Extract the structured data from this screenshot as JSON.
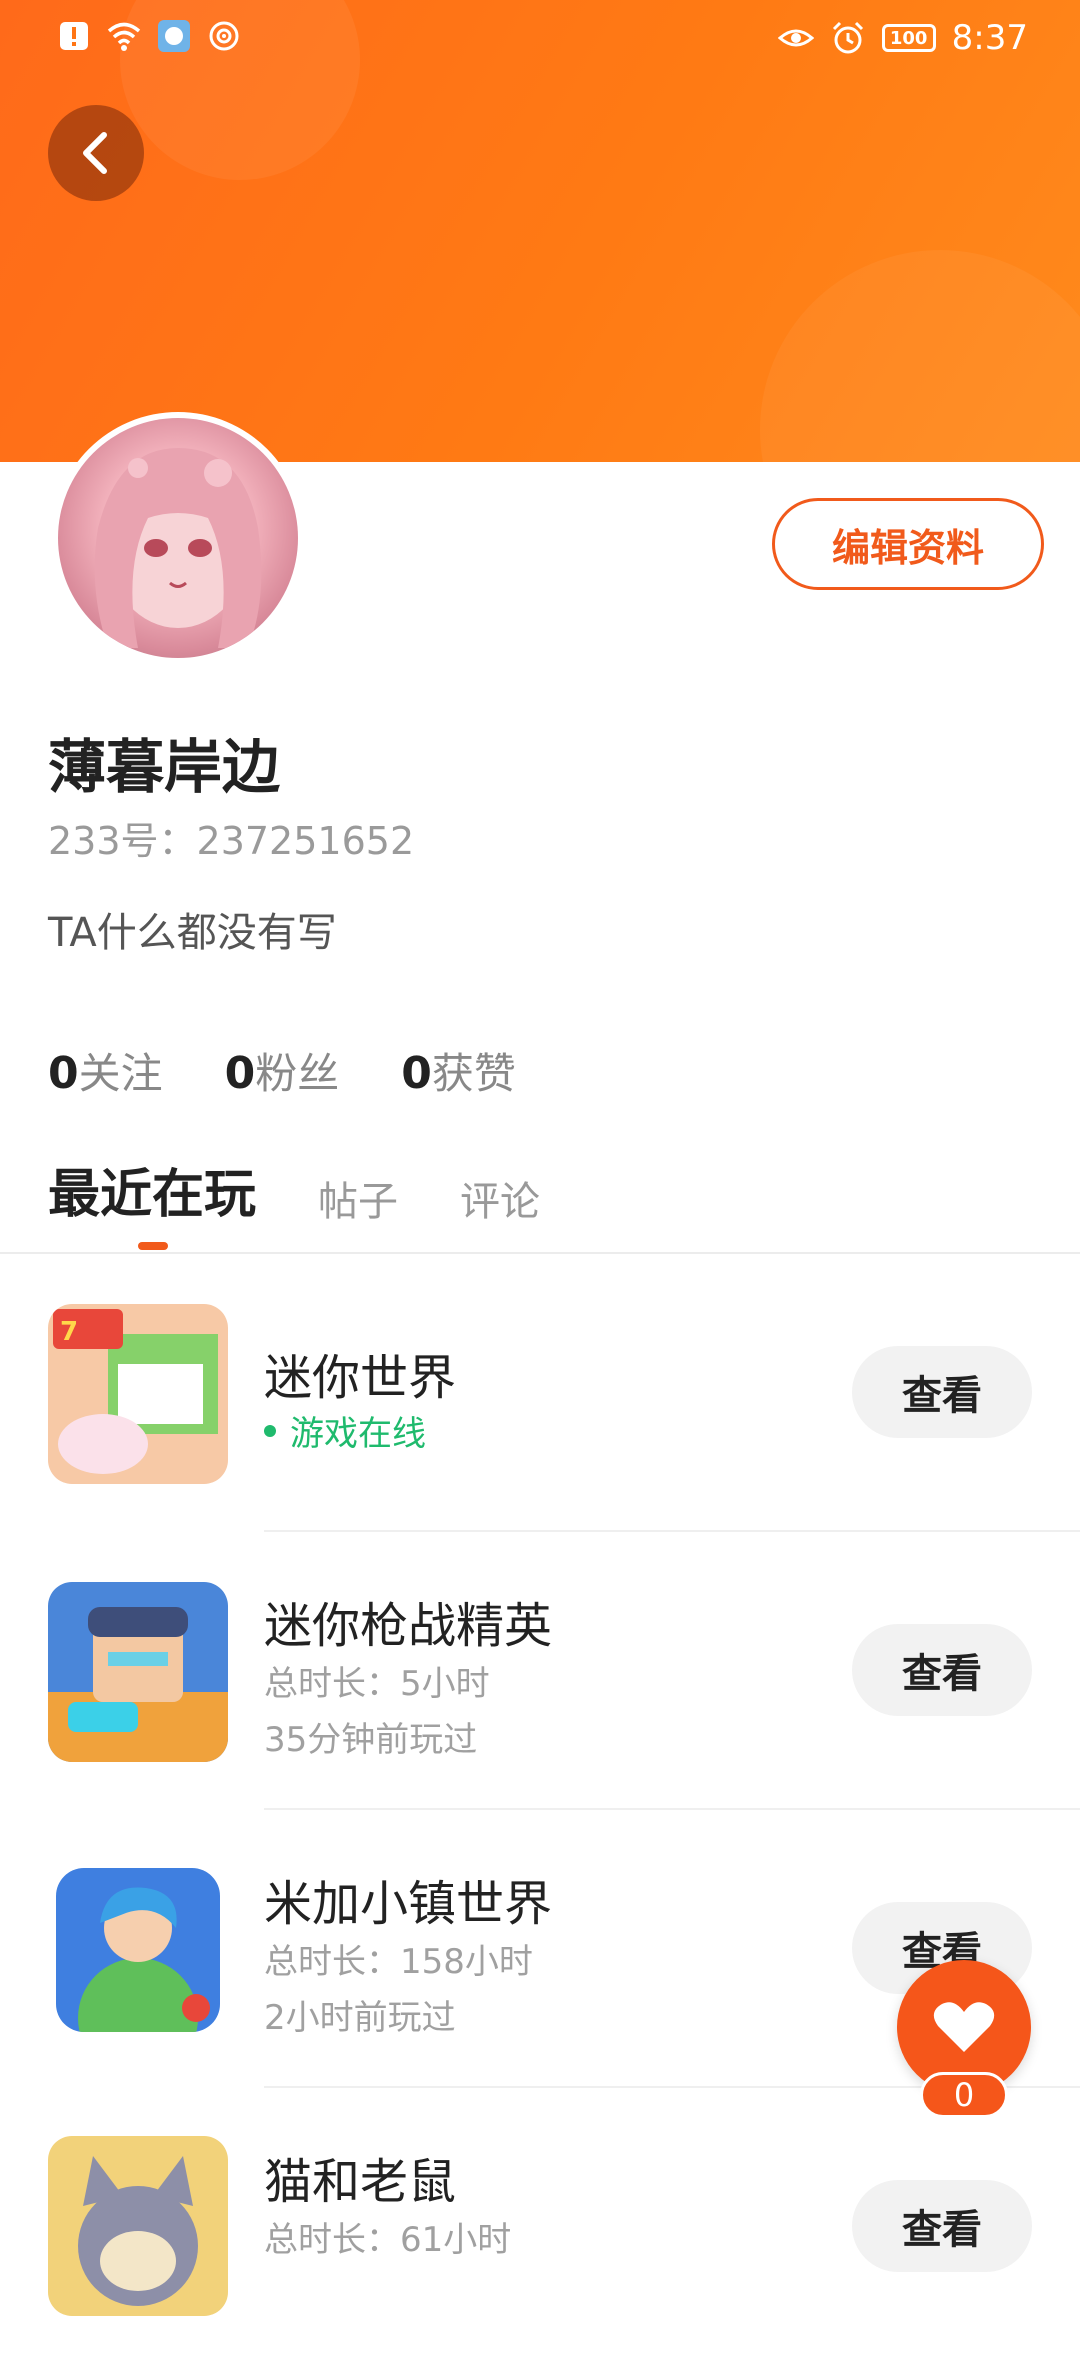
{
  "status_bar": {
    "time": "8:37",
    "battery": "100",
    "icons": [
      "alert-icon",
      "wifi-icon",
      "app-notification-icon",
      "hotspot-icon",
      "eye-icon",
      "alarm-icon",
      "battery-icon"
    ]
  },
  "colors": {
    "accent": "#f15a1b",
    "banner": "#ff7514",
    "online": "#1fba6d"
  },
  "profile": {
    "name": "薄暮岸边",
    "uid": "233号：237251652",
    "bio": "TA什么都没有写",
    "edit_label": "编辑资料"
  },
  "stats": [
    {
      "value": "0",
      "label": "关注"
    },
    {
      "value": "0",
      "label": "粉丝"
    },
    {
      "value": "0",
      "label": "获赞"
    }
  ],
  "tabs": [
    {
      "label": "最近在玩",
      "active": true
    },
    {
      "label": "帖子",
      "active": false
    },
    {
      "label": "评论",
      "active": false
    }
  ],
  "games": [
    {
      "title": "迷你世界",
      "online": "游戏在线",
      "button": "查看"
    },
    {
      "title": "迷你枪战精英",
      "duration": "总时长：5小时",
      "last_played": "35分钟前玩过",
      "button": "查看"
    },
    {
      "title": "米加小镇世界",
      "duration": "总时长：158小时",
      "last_played": "2小时前玩过",
      "button": "查看"
    },
    {
      "title": "猫和老鼠",
      "duration": "总时长：61小时",
      "button": "查看"
    }
  ],
  "like": {
    "count": "0"
  }
}
